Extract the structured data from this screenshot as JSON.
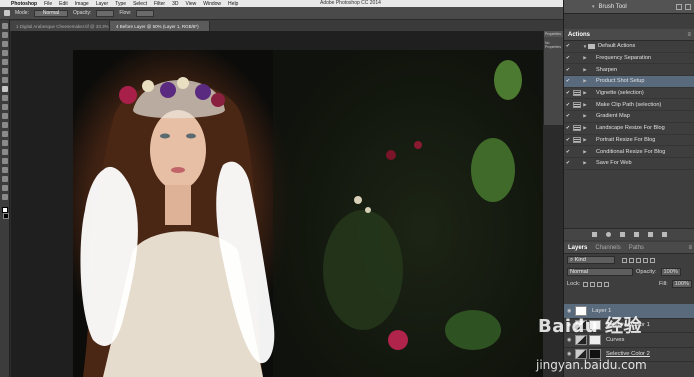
{
  "menubar": {
    "apple": "",
    "app_name": "Photoshop",
    "items": [
      "File",
      "Edit",
      "Image",
      "Layer",
      "Type",
      "Select",
      "Filter",
      "3D",
      "View",
      "Window",
      "Help"
    ],
    "window_title": "Adobe Photoshop CC 2014"
  },
  "options_bar": {
    "mode_label": "Mode:",
    "mode_value": "Normal",
    "opacity_label": "Opacity:",
    "flow_label": "Flow:"
  },
  "doc_tabs": [
    {
      "label": "1 Digital Arabesque Cheesemaker.tif @ 33.3% (Layer 1, RGB/8*)"
    },
    {
      "label": "4 Before Layer @ 50% (Layer 1, RGB/8*)"
    }
  ],
  "right_panel": {
    "brush_tool_title": "Brush Tool",
    "actions_tab": "Actions",
    "actions": [
      {
        "label": "Default Actions",
        "type": "set",
        "checked": true,
        "dialog": false
      },
      {
        "label": "Frequency Separation",
        "checked": true,
        "dialog": false
      },
      {
        "label": "Sharpen",
        "checked": true,
        "dialog": false
      },
      {
        "label": "Product Shot Setup",
        "checked": true,
        "dialog": false,
        "selected": true
      },
      {
        "label": "Vignette (selection)",
        "checked": true,
        "dialog": true
      },
      {
        "label": "Make Clip Path (selection)",
        "checked": true,
        "dialog": true
      },
      {
        "label": "Gradient Map",
        "checked": true,
        "dialog": false
      },
      {
        "label": "Landscape Resize For Blog",
        "checked": true,
        "dialog": true
      },
      {
        "label": "Portrait Resize For Blog",
        "checked": true,
        "dialog": true
      },
      {
        "label": "Conditional Resize For Blog",
        "checked": true,
        "dialog": false
      },
      {
        "label": "Save For Web",
        "checked": true,
        "dialog": false
      }
    ],
    "layers_tabs": [
      "Layers",
      "Channels",
      "Paths"
    ],
    "kind_label": "Kind",
    "blend_mode": "Normal",
    "opacity_label": "Opacity:",
    "opacity_value": "100%",
    "lock_label": "Lock:",
    "fill_label": "Fill:",
    "fill_value": "100%",
    "layers": [
      {
        "name": "Layer 1",
        "thumb": "white",
        "selected": true
      },
      {
        "name": "Selective Color 1",
        "thumb": "adj",
        "selected": false
      },
      {
        "name": "Curves",
        "thumb": "adj",
        "selected": false
      },
      {
        "name": "Selective Color 2",
        "thumb": "black",
        "selected": false
      }
    ]
  },
  "props_mini": {
    "tab1": "Properties",
    "tab2": "No Properties"
  },
  "watermark": {
    "main": "Baidu 经验",
    "sub": "jingyan.baidu.com"
  }
}
